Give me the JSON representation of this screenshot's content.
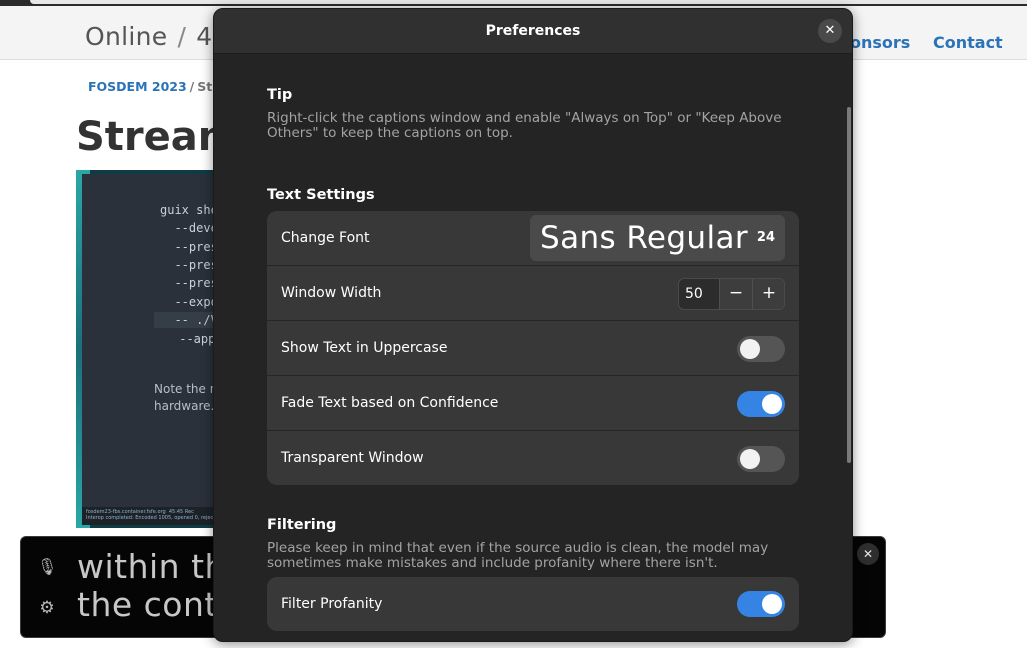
{
  "page": {
    "site_title_part1": "Online",
    "site_title_sep": "/",
    "site_title_part2": "4",
    "nav_links": [
      "onsors",
      "Contact"
    ],
    "breadcrumb_first": "FOSDEM 2023",
    "breadcrumb_sep": "/",
    "breadcrumb_second": "Str",
    "heading": "Stream"
  },
  "video": {
    "code_lines": [
      "guix shel",
      "  --deve",
      "  --prese",
      "  --prese",
      "  --prese",
      "  --expo",
      "  -- ./VSC",
      " --appin"
    ],
    "note_lines": [
      "Note the n",
      "hardware."
    ],
    "status_line": "fosdem23-fbs.container.fsfe.org  45:45 Rec\nInterop completed: Encoded 1005, opened 0, rejected"
  },
  "captions": {
    "line1": "within th",
    "line2": "the cont",
    "mic_icon": "🎙",
    "gear_icon": "⚙",
    "close_icon": "✕"
  },
  "dialog": {
    "title": "Preferences",
    "close_icon": "✕",
    "tip_title": "Tip",
    "tip_text": "Right-click the captions window and enable \"Always on Top\" or \"Keep Above Others\" to keep the captions on top.",
    "text_settings_title": "Text Settings",
    "change_font_label": "Change Font",
    "font_name": "Sans Regular",
    "font_size": "24",
    "window_width_label": "Window Width",
    "window_width_value": "50",
    "minus_icon": "−",
    "plus_icon": "+",
    "uppercase_label": "Show Text in Uppercase",
    "uppercase_on": false,
    "fade_label": "Fade Text based on Confidence",
    "fade_on": true,
    "transparent_label": "Transparent Window",
    "transparent_on": false,
    "filtering_title": "Filtering",
    "filtering_text": "Please keep in mind that even if the source audio is clean, the model may sometimes make mistakes and include profanity where there isn't.",
    "filter_profanity_label": "Filter Profanity",
    "filter_profanity_on": true
  },
  "colors": {
    "accent": "#3584e4",
    "dialog_bg": "#242424",
    "row_bg": "#383838",
    "link": "#2a73b8"
  }
}
